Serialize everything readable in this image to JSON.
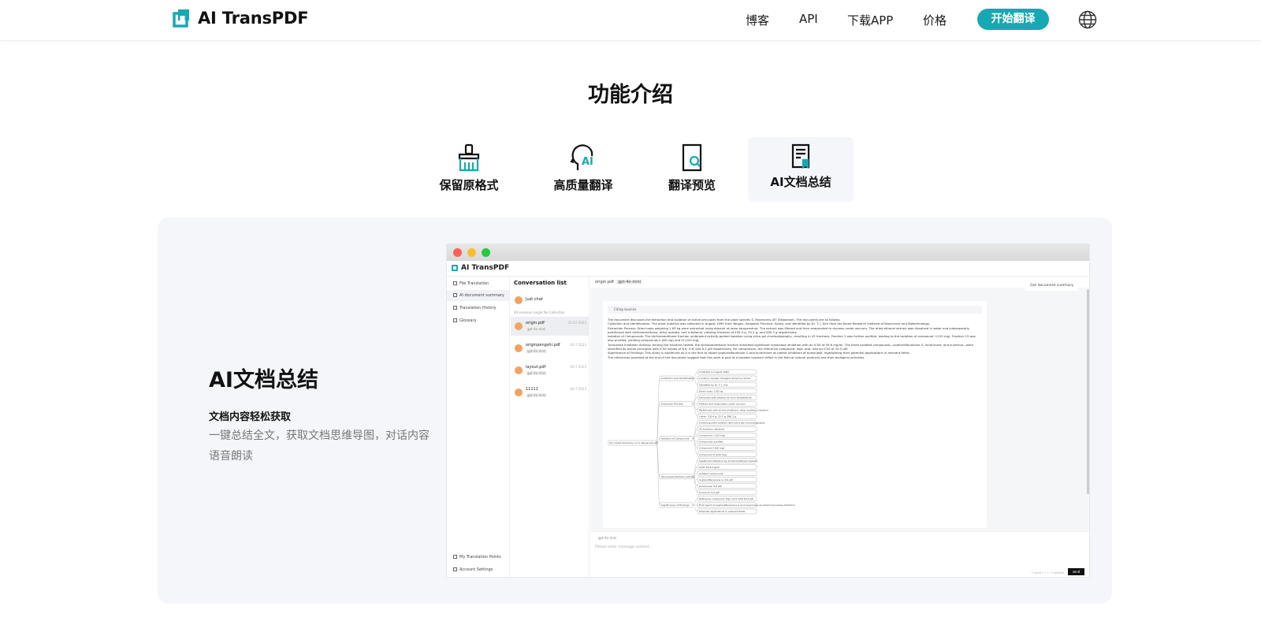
{
  "header": {
    "logo_text": "AI TransPDF",
    "nav": [
      "博客",
      "API",
      "下载APP",
      "价格"
    ],
    "cta_label": "开始翻译",
    "lang_icon": "globe-icon"
  },
  "section": {
    "title": "功能介绍",
    "tabs": [
      {
        "label": "保留原格式",
        "icon": "brush-icon"
      },
      {
        "label": "高质量翻译",
        "icon": "ai-head-icon"
      },
      {
        "label": "翻译预览",
        "icon": "document-search-icon"
      },
      {
        "label": "AI文档总结",
        "icon": "document-summary-icon",
        "active": true
      }
    ]
  },
  "feature": {
    "title": "AI文档总结",
    "subtitle": "文档内容轻松获取",
    "description": "一键总结全文，获取文档思维导图，对话内容语音朗读"
  },
  "app": {
    "logo": "AI TransPDF",
    "nav_items": [
      "File Translation",
      "AI document summary",
      "Translation History",
      "Glossary"
    ],
    "nav_bottom": [
      "My Translation Points",
      "Account Settings"
    ],
    "conversation_title": "Conversation list",
    "just_chat": "Just chat",
    "sessions_filter": "All sessions   single file   Collection",
    "conversations": [
      {
        "name": "origin.pdf",
        "tag": "gpt-4o-mini",
        "date": "25-07-2023"
      },
      {
        "name": "originpengshi.pdf",
        "tag": "gpt-4o-mini",
        "date": "26-7-2023"
      },
      {
        "name": "layout.pdf",
        "tag": "gpt-4o-mini",
        "date": "26-7-2023"
      },
      {
        "name": "11111",
        "tag": "gpt-4o-mini",
        "date": "26-7-2023"
      }
    ],
    "doc_tab": "origin.pdf",
    "doc_model": "gpt-4o-mini",
    "get_summary": "Get document summary",
    "citing": "Citing sources",
    "summary_lines": [
      "The document discusses the extraction and isolation of active principles from the plant species S. flavescens AIT (Fabaceae). The key points are as follows:",
      "Collection and Identification: The plant material was collected in August 1990 from Yangku, Kangwon Province, Korea, and identified by Dr. T. J. Kim from the Korea Research Institute of Bioscience and Biotechnology.",
      "Extraction Process: Dried roots weighing 1.65 kg were extracted using ethanol at room temperature. The extract was filtered and then evaporated to dryness under vacuum. The dried ethanol extract was dissolved in water and subsequently partitioned with dichloromethane, ethyl acetate, and n-butanol, yielding fractions of 130.4 g, 25.5 g, and 280.3 g respectively.",
      "Isolation of Compounds: The dichloromethane fraction underwent activity-guided isolation using silica gel chromatography, resulting in 43 fractions. Fraction 2 was further purified, leading to the isolation of compound I (120 mg). Fraction 23 was also purified, yielding compounds II (80 mg) and III (220 mg).",
      "Tyrosinase Inhibition Activity: Among the fractions tested, the dichloromethane fraction exhibited significant tyrosinase inhibition with an IC50 of 59.6 mg/ml. The three isolated compounds—sophoraflavanone G, kurarinone, and kurarinol—were identified as active principles with IC50 values of 6.6, 0.6, and 6.2 µM respectively. For comparison, the reference compound, kojic acid, had an IC50 of 20.5 µM.",
      "Significance of Findings: This study is significant as it is the first to report sophoraflavanone G and kurarinone as potent inhibitors of tyrosinase, highlighting their potential applications in relevant fields.",
      "The references provided at the end of the document suggest that this work is part of a broader research effort in the field of natural products and their biological activities."
    ],
    "mindmap": {
      "root": "Document Summary on S. flavescens AIT",
      "branches": [
        "Collection and Identification",
        "Extraction Process",
        "Isolation of Compounds",
        "Tyrosinase Inhibition Activity",
        "Significance of Findings"
      ],
      "leaves": [
        "Collected in August 1990",
        "Location: Yangku, Kangwon Province, Korea",
        "Identified by Dr. T. J. Kim",
        "Dried roots: 1.65 kg",
        "Extracted with ethanol at room temperature",
        "Filtered and evaporated under vacuum",
        "Partitioned with dichloromethane, ethyl acetate, n-butanol",
        "Yields: 130.4 g, 25.5 g, 280.3 g",
        "Activity-guided isolation with silica gel chromatography",
        "43 fractions obtained",
        "Compound I (120 mg)",
        "Compounds purified",
        "Compound II (80 mg)",
        "Compound III (220 mg)",
        "Significant inhibition by dichloromethane fraction",
        "IC50: 59.6 mg/ml",
        "Isolated compounds",
        "Sophoraflavanone G: 6.6 µM",
        "Kurarinone: 0.6 µM",
        "Kurarinol: 6.2 µM",
        "Reference compound: Kojic acid IC50 20.5 µM",
        "First report of sophoraflavanone G and kurarinone as potent tyrosinase inhibitors",
        "Potential applications in relevant fields"
      ]
    },
    "model_chip": "gpt-4o-mini",
    "input_placeholder": "Please enter message content...",
    "send_label": "send",
    "hint": "⏎ send / ⇧ + ⏎ newline"
  }
}
